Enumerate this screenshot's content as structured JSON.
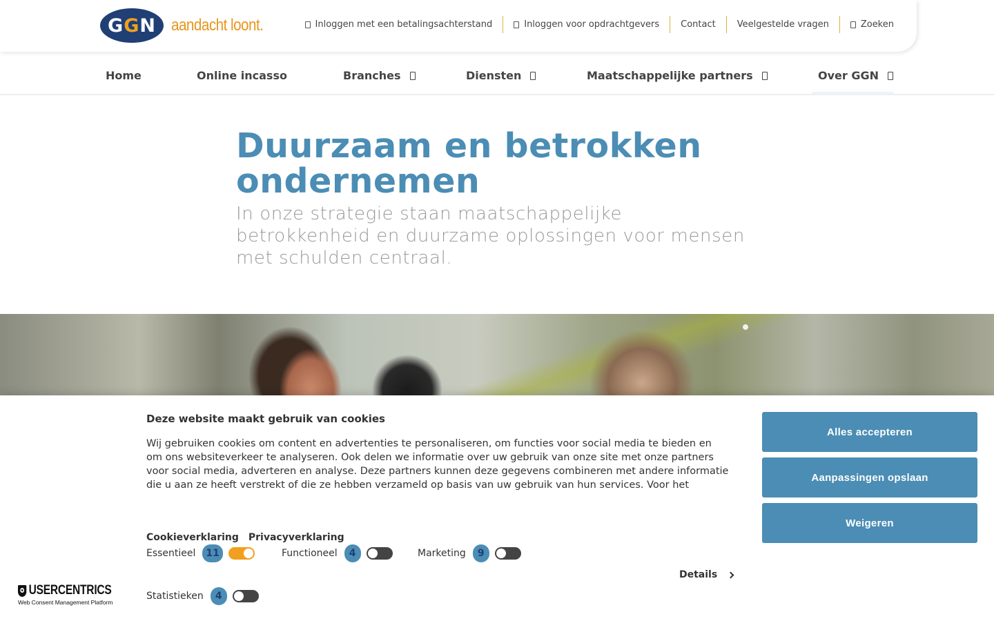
{
  "header": {
    "logo": {
      "letters": [
        "G",
        "G",
        "N"
      ],
      "tagline": "aandacht loont."
    },
    "top_links": [
      {
        "label": "Inloggen met een betalingsachterstand",
        "icon": "lock-icon"
      },
      {
        "label": "Inloggen voor opdrachtgevers",
        "icon": "lock-icon"
      },
      {
        "label": "Contact"
      },
      {
        "label": "Veelgestelde vragen"
      },
      {
        "label": "Zoeken",
        "icon": "search-icon"
      }
    ]
  },
  "nav": {
    "items": [
      {
        "label": "Home"
      },
      {
        "label": "Online incasso"
      },
      {
        "label": "Branches",
        "has_dropdown": true
      },
      {
        "label": "Diensten",
        "has_dropdown": true
      },
      {
        "label": "Maatschappelijke partners",
        "has_dropdown": true
      },
      {
        "label": "Over GGN",
        "has_dropdown": true,
        "active": true
      }
    ]
  },
  "hero": {
    "title": "Duurzaam en betrokken ondernemen",
    "subtitle": "In onze strategie staan maatschappelijke betrokkenheid en duurzame oplossingen voor mensen met schulden centraal."
  },
  "cookie_banner": {
    "title": "Deze website maakt gebruik van cookies",
    "text": "Wij gebruiken cookies om content en advertenties te personaliseren, om functies voor social media te bieden en om ons websiteverkeer te analyseren. Ook delen we informatie over uw gebruik van onze site met onze partners voor social media, adverteren en analyse. Deze partners kunnen deze gegevens combineren met andere informatie die u aan ze heeft verstrekt of die ze hebben verzameld op basis van uw gebruik van hun services. Voor het overzicht over de",
    "links": [
      "Cookieverklaring",
      "Privacyverklaring"
    ],
    "categories": [
      {
        "label": "Essentieel",
        "count": "11",
        "enabled": true
      },
      {
        "label": "Functioneel",
        "count": "4",
        "enabled": false
      },
      {
        "label": "Marketing",
        "count": "9",
        "enabled": false
      },
      {
        "label": "Statistieken",
        "count": "4",
        "enabled": false
      }
    ],
    "details_label": "Details",
    "buttons": {
      "accept_all": "Alles accepteren",
      "save": "Aanpassingen opslaan",
      "deny": "Weigeren"
    },
    "provider": {
      "name": "USERCENTRICS",
      "tagline": "Web Consent Management Platform"
    }
  },
  "colors": {
    "brand_blue": "#4b8db4",
    "navy": "#1f3f75",
    "orange": "#f0a01e"
  }
}
